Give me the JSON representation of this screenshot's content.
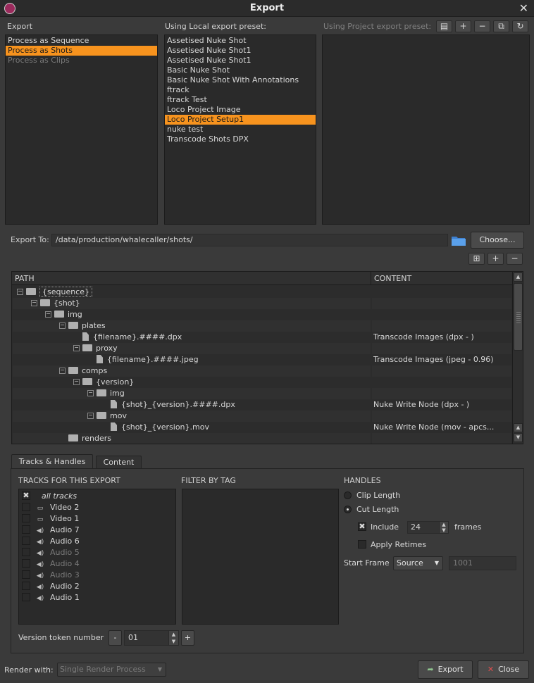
{
  "window": {
    "title": "Export"
  },
  "export_section": {
    "label": "Export",
    "items": [
      {
        "label": "Process as Sequence",
        "state": "normal"
      },
      {
        "label": "Process as Shots",
        "state": "selected"
      },
      {
        "label": "Process as Clips",
        "state": "disabled"
      }
    ]
  },
  "local_presets": {
    "label": "Using Local export preset:",
    "items": [
      {
        "label": "Assetised Nuke Shot",
        "state": "normal"
      },
      {
        "label": "Assetised Nuke Shot1",
        "state": "normal"
      },
      {
        "label": "Assetised Nuke Shot1",
        "state": "normal"
      },
      {
        "label": "Basic Nuke Shot",
        "state": "normal"
      },
      {
        "label": "Basic Nuke Shot With Annotations",
        "state": "normal"
      },
      {
        "label": "ftrack",
        "state": "normal"
      },
      {
        "label": "ftrack Test",
        "state": "normal"
      },
      {
        "label": "Loco Project Image",
        "state": "normal"
      },
      {
        "label": "Loco Project Setup1",
        "state": "selected"
      },
      {
        "label": "nuke test",
        "state": "normal"
      },
      {
        "label": "Transcode Shots DPX",
        "state": "normal"
      }
    ]
  },
  "project_presets": {
    "label": "Using Project export preset:",
    "toolbar_icons": [
      "new-preset-icon",
      "add-icon",
      "remove-icon",
      "copy-preset-icon",
      "refresh-icon"
    ],
    "toolbar_glyphs": [
      "▤",
      "+",
      "−",
      "⧉",
      "↻"
    ]
  },
  "export_to": {
    "label": "Export To:",
    "path": "/data/production/whalecaller/shots/",
    "choose_label": "Choose..."
  },
  "tree_toolbar": {
    "glyphs": [
      "⊞",
      "+",
      "−"
    ]
  },
  "tree": {
    "columns": [
      "PATH",
      "CONTENT"
    ],
    "rows": [
      {
        "name": "{sequence}",
        "content": ""
      },
      {
        "name": "{shot}",
        "content": ""
      },
      {
        "name": "img",
        "content": ""
      },
      {
        "name": "plates",
        "content": ""
      },
      {
        "name": "{filename}.####.dpx",
        "content": "Transcode Images (dpx - )"
      },
      {
        "name": "proxy",
        "content": ""
      },
      {
        "name": "{filename}.####.jpeg",
        "content": "Transcode Images (jpeg - 0.96)"
      },
      {
        "name": "comps",
        "content": ""
      },
      {
        "name": "{version}",
        "content": ""
      },
      {
        "name": "img",
        "content": ""
      },
      {
        "name": "{shot}_{version}.####.dpx",
        "content": "Nuke Write Node (dpx - )"
      },
      {
        "name": "mov",
        "content": ""
      },
      {
        "name": "{shot}_{version}.mov",
        "content": "Nuke Write Node (mov - apcs..."
      },
      {
        "name": "renders",
        "content": ""
      }
    ]
  },
  "tabs": [
    {
      "label": "Tracks & Handles",
      "active": true
    },
    {
      "label": "Content",
      "active": false
    }
  ],
  "tracks": {
    "label": "TRACKS FOR THIS EXPORT",
    "items": [
      {
        "label": "all tracks",
        "checked": true,
        "icon": "",
        "enabled": true
      },
      {
        "label": "Video 2",
        "checked": false,
        "icon": "monitor-icon",
        "enabled": true
      },
      {
        "label": "Video 1",
        "checked": false,
        "icon": "monitor-icon",
        "enabled": true
      },
      {
        "label": "Audio 7",
        "checked": false,
        "icon": "speaker-icon",
        "enabled": true
      },
      {
        "label": "Audio 6",
        "checked": false,
        "icon": "speaker-icon",
        "enabled": true
      },
      {
        "label": "Audio 5",
        "checked": false,
        "icon": "speaker-icon",
        "enabled": false
      },
      {
        "label": "Audio 4",
        "checked": false,
        "icon": "speaker-icon",
        "enabled": false
      },
      {
        "label": "Audio 3",
        "checked": false,
        "icon": "speaker-icon",
        "enabled": false
      },
      {
        "label": "Audio 2",
        "checked": false,
        "icon": "speaker-icon",
        "enabled": true
      },
      {
        "label": "Audio 1",
        "checked": false,
        "icon": "speaker-icon",
        "enabled": true
      }
    ]
  },
  "filter": {
    "label": "FILTER BY TAG"
  },
  "handles": {
    "label": "HANDLES",
    "clip_length": "Clip Length",
    "cut_length": "Cut Length",
    "selected": "cut_length",
    "include_label": "Include",
    "include_checked": true,
    "frames_value": "24",
    "frames_label": "frames",
    "apply_retimes": "Apply Retimes",
    "apply_retimes_checked": false,
    "start_frame_label": "Start Frame",
    "start_frame_source": "Source",
    "start_frame_value": "1001"
  },
  "version": {
    "label": "Version token number",
    "minus": "-",
    "value": "01",
    "plus": "+"
  },
  "footer": {
    "render_label": "Render with:",
    "render_value": "Single Render Process",
    "export_label": "Export",
    "close_label": "Close"
  }
}
